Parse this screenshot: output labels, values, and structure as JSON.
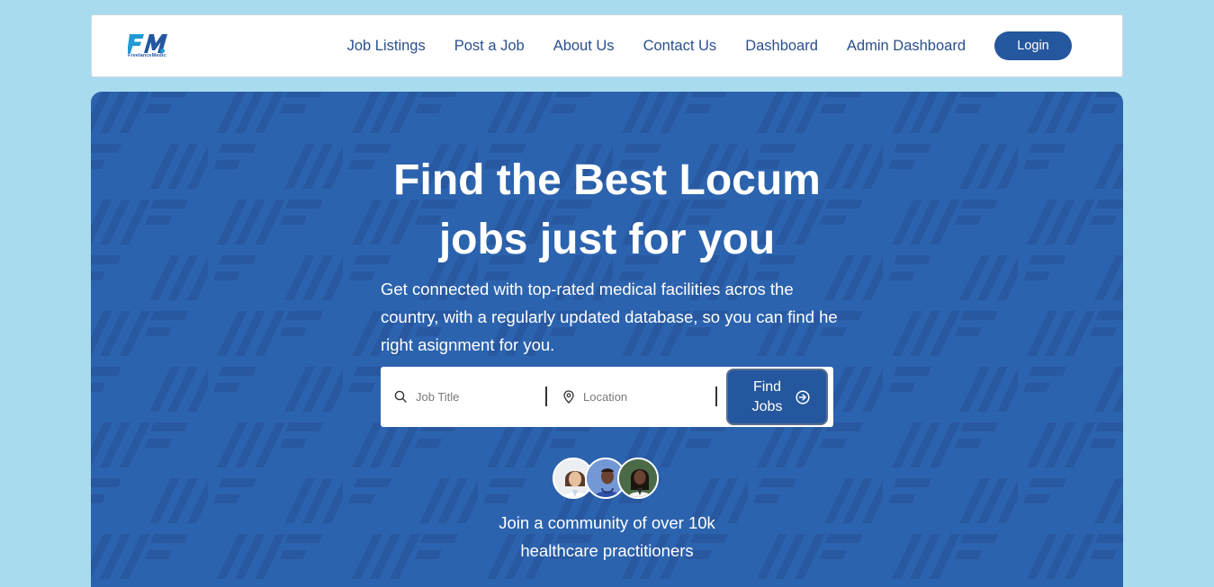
{
  "brand": {
    "mark": "FM",
    "name": "FreelanceMedic"
  },
  "nav": {
    "links": [
      "Job Listings",
      "Post a Job",
      "About Us",
      "Contact Us",
      "Dashboard",
      "Admin Dashboard"
    ],
    "login_label": "Login"
  },
  "hero": {
    "title_line1": "Find the Best Locum",
    "title_line2": "jobs just for you",
    "subtitle_line1": "Get connected with top-rated medical facilities acros the",
    "subtitle_line2": "country, with a regularly updated database, so you can find he",
    "subtitle_line3": "right asignment for you."
  },
  "search": {
    "job_title_placeholder": "Job Title",
    "location_placeholder": "Location",
    "find_button_label": "Find Jobs"
  },
  "community": {
    "line1": "Join a community of over 10k",
    "line2": "healthcare practitioners"
  },
  "colors": {
    "page_bg": "#a8dbee",
    "hero_bg": "#2c63ae",
    "accent": "#24579e",
    "nav_text": "#2a4f8f"
  },
  "icons": {
    "search": "search-icon",
    "location": "location-pin-icon",
    "find_arrow": "arrow-right-circle-icon"
  }
}
